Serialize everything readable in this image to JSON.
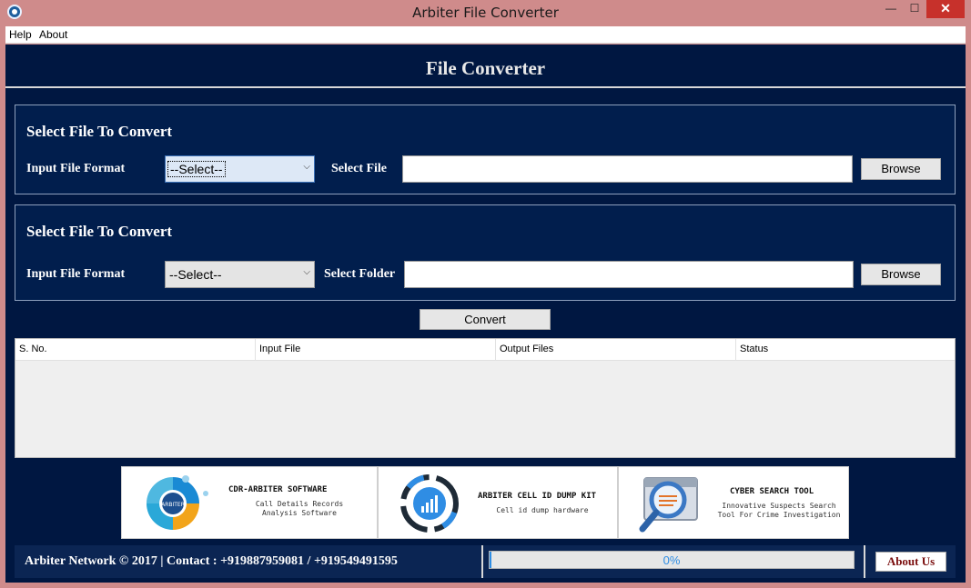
{
  "window": {
    "title": "Arbiter File Converter",
    "minimize_glyph": "—",
    "maximize_glyph": "☐",
    "close_glyph": "✕"
  },
  "menu": {
    "items": [
      "Help",
      "About"
    ]
  },
  "header": {
    "title": "File Converter"
  },
  "file_panel": {
    "title": "Select File To Convert",
    "format_label": "Input File Format",
    "format_selected": "--Select--",
    "path_label": "Select File",
    "path_value": "",
    "browse_label": "Browse"
  },
  "folder_panel": {
    "title": "Select File To Convert",
    "format_label": "Input File Format",
    "format_selected": "--Select--",
    "path_label": "Select Folder",
    "path_value": "",
    "browse_label": "Browse"
  },
  "convert_label": "Convert",
  "table": {
    "columns": [
      "S. No.",
      "Input File",
      "Output Files",
      "Status"
    ],
    "rows": []
  },
  "banners": [
    {
      "title": "CDR-ARBITER SOFTWARE",
      "line1": "Call Details Records",
      "line2": "Analysis Software",
      "logo_text": "ARBITER"
    },
    {
      "title": "ARBITER CELL ID DUMP KIT",
      "line1": "Cell id dump hardware"
    },
    {
      "title": "CYBER SEARCH TOOL",
      "line1": "Innovative Suspects Search",
      "line2": "Tool For Crime Investigation"
    }
  ],
  "footer": {
    "copyright": "Arbiter Network © 2017 |  Contact : +919887959081 / +919549491595",
    "progress_percent": 0,
    "progress_text": "0%",
    "about_label": "About Us"
  },
  "colors": {
    "background": "#001741",
    "panel": "#011e4d",
    "footer": "#0b2553",
    "progress": "#2f8de4",
    "about_text": "#7a0d0d",
    "titlebar": "#cf8b8b",
    "close": "#c7312b"
  }
}
